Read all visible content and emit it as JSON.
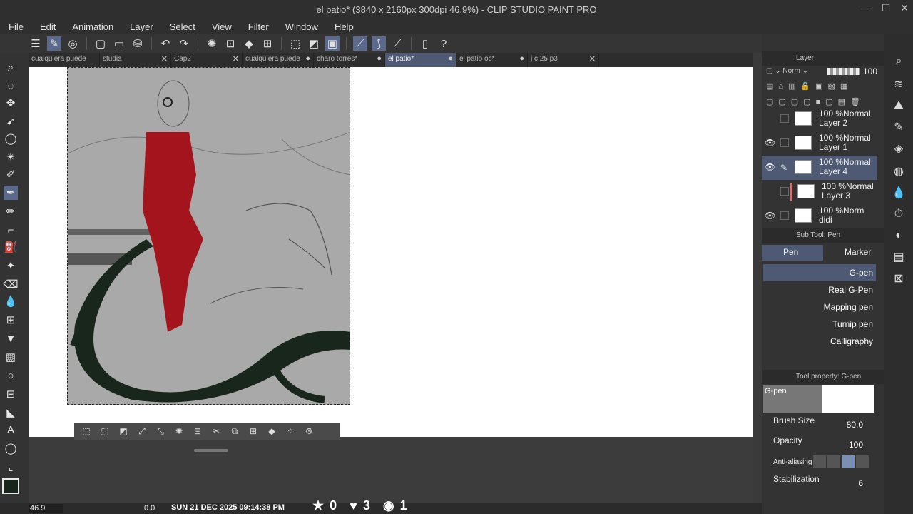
{
  "window": {
    "title": "el patio* (3840 x 2160px 300dpi 46.9%)  - CLIP STUDIO PAINT PRO"
  },
  "menu": [
    "File",
    "Edit",
    "Animation",
    "Layer",
    "Select",
    "View",
    "Filter",
    "Window",
    "Help"
  ],
  "tabs": [
    {
      "label": "cualquiera puede",
      "active": false
    },
    {
      "label": "studia",
      "active": false
    },
    {
      "label": "Cap2",
      "active": false
    },
    {
      "label": "cualquiera puede",
      "active": false
    },
    {
      "label": "charo torres*",
      "active": false
    },
    {
      "label": "el patio*",
      "active": true
    },
    {
      "label": "el patio oc*",
      "active": false
    },
    {
      "label": "j c 25 p3",
      "active": false
    }
  ],
  "layer_panel": {
    "title": "Layer",
    "blend_mode": "Norm",
    "opacity": "100",
    "layers": [
      {
        "percent": "100 %",
        "mode": "Normal",
        "name": "Layer 2",
        "visible": false,
        "selected": false
      },
      {
        "percent": "100 %",
        "mode": "Normal",
        "name": "Layer 1",
        "visible": true,
        "selected": false
      },
      {
        "percent": "100 %",
        "mode": "Normal",
        "name": "Layer 4",
        "visible": true,
        "selected": true
      },
      {
        "percent": "100 %",
        "mode": "Normal",
        "name": "Layer 3",
        "visible": false,
        "selected": false
      },
      {
        "percent": "100 %",
        "mode": "Norm",
        "name": "didi",
        "visible": true,
        "selected": false
      }
    ]
  },
  "sub_tool": {
    "title": "Sub Tool: Pen",
    "tabs": [
      "Pen",
      "Marker"
    ],
    "brushes": [
      "G-pen",
      "Real G-Pen",
      "Mapping pen",
      "Turnip pen",
      "Calligraphy"
    ]
  },
  "tool_property": {
    "title": "Tool property: G-pen",
    "preview_label": "G-pen",
    "brush_size_label": "Brush Size",
    "brush_size": "80.0",
    "opacity_label": "Opacity",
    "opacity": "100",
    "antialias_label": "Anti-aliasing",
    "stabilization_label": "Stabilization",
    "stabilization": "6"
  },
  "status": {
    "zoom": "46.9",
    "angle": "0.0",
    "clock": "SUN 21 DEC 2025 09:14:38 PM"
  },
  "overlay_stats": {
    "stars": "0",
    "hearts": "3",
    "views": "1"
  },
  "colors": {
    "accent": "#5b6a8c",
    "brush_red": "#a3141c",
    "dragon_green": "#19261c",
    "canvas_gray": "#a9a9a9"
  }
}
